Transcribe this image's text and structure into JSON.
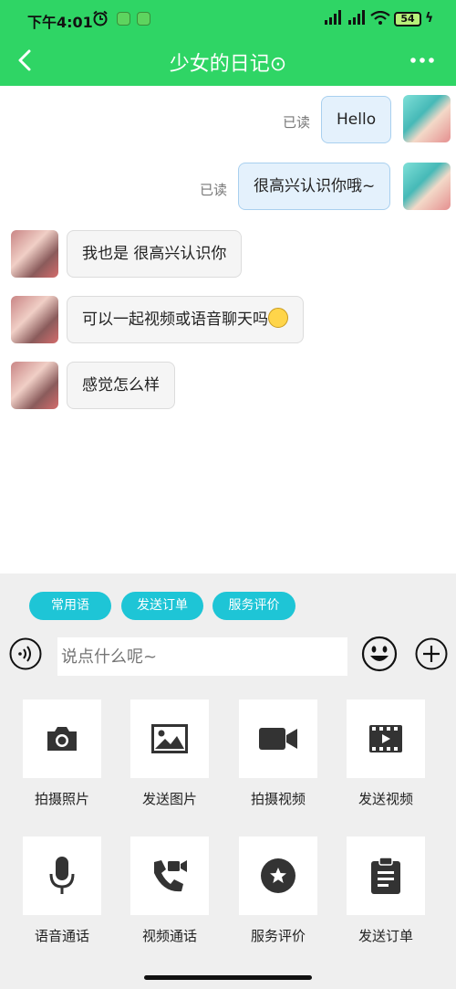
{
  "status_bar": {
    "time": "下午4:01",
    "battery": "54"
  },
  "header": {
    "title": "少女的日记⊙"
  },
  "messages": [
    {
      "text": "Hello",
      "read": "已读"
    },
    {
      "text": "很高兴认识你哦~",
      "read": "已读"
    },
    {
      "text": "我也是 很高兴认识你"
    },
    {
      "text": "可以一起视频或语音聊天吗"
    },
    {
      "text": "感觉怎么样"
    }
  ],
  "quick_replies": [
    "常用语",
    "发送订单",
    "服务评价"
  ],
  "input": {
    "placeholder": "说点什么呢~"
  },
  "tools": [
    {
      "label": "拍摄照片",
      "icon": "camera-icon"
    },
    {
      "label": "发送图片",
      "icon": "image-icon"
    },
    {
      "label": "拍摄视频",
      "icon": "video-camera-icon"
    },
    {
      "label": "发送视频",
      "icon": "film-icon"
    },
    {
      "label": "语音通话",
      "icon": "microphone-icon"
    },
    {
      "label": "视频通话",
      "icon": "video-call-icon"
    },
    {
      "label": "服务评价",
      "icon": "star-badge-icon"
    },
    {
      "label": "发送订单",
      "icon": "clipboard-icon"
    }
  ],
  "colors": {
    "header_green": "#2fd565",
    "quick_reply_cyan": "#1ec5d6",
    "icon_dark": "#333333"
  }
}
